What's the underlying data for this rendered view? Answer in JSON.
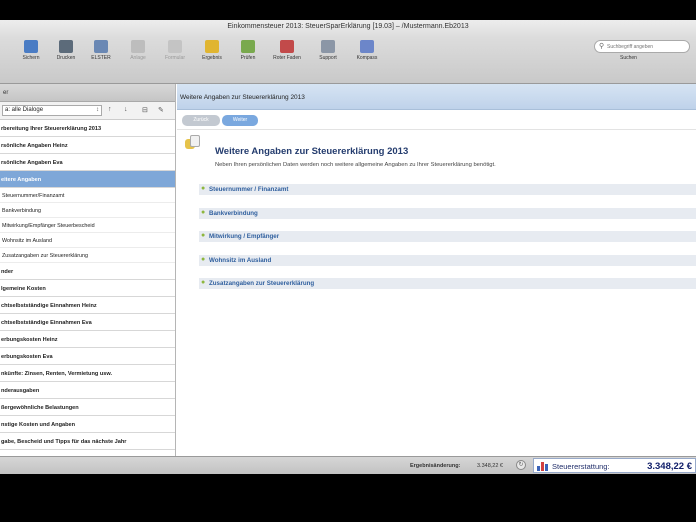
{
  "window": {
    "title": "Einkommensteuer 2013: SteuerSparErklärung [19.03] – /Mustermann.Eb2013"
  },
  "toolbar": {
    "buttons": [
      {
        "label": "Sichern",
        "icon": "save-icon",
        "color": "#4a7cc4",
        "enabled": true
      },
      {
        "label": "Drucken",
        "icon": "printer-icon",
        "color": "#5c6b7a",
        "enabled": true
      },
      {
        "label": "ELSTER",
        "icon": "elster-send-icon",
        "color": "#6a88b4",
        "enabled": true
      },
      {
        "label": "Anlage",
        "icon": "attachment-icon",
        "color": "#bdbdbd",
        "enabled": false
      },
      {
        "label": "Formular",
        "icon": "magnifier-icon",
        "color": "#c4c4c4",
        "enabled": false
      },
      {
        "label": "Ergebnis",
        "icon": "result-icon",
        "color": "#e0b531",
        "enabled": true
      },
      {
        "label": "Prüfen",
        "icon": "check-icon",
        "color": "#79a94e",
        "enabled": true
      },
      {
        "label": "Roter Faden",
        "icon": "red-thread-icon",
        "color": "#c24a4a",
        "enabled": true
      },
      {
        "label": "Support",
        "icon": "support-icon",
        "color": "#8b96a6",
        "enabled": true
      },
      {
        "label": "Kompass",
        "icon": "compass-icon",
        "color": "#6c86c9",
        "enabled": true
      }
    ],
    "search": {
      "placeholder": "Suchbegriff angeben",
      "label": "Suchen"
    }
  },
  "sidebar": {
    "header": "er",
    "filter": {
      "selected": "a: alle Dialoge"
    },
    "items": [
      {
        "label": "rbereitung Ihrer Steuererklärung 2013",
        "type": "main",
        "selected": false
      },
      {
        "label": "rsönliche Angaben Heinz",
        "type": "main",
        "selected": false
      },
      {
        "label": "rsönliche Angaben Eva",
        "type": "main",
        "selected": false
      },
      {
        "label": "eitere Angaben",
        "type": "main",
        "selected": true
      },
      {
        "label": "Steuernummer/Finanzamt",
        "type": "sub",
        "selected": false
      },
      {
        "label": "Bankverbindung",
        "type": "sub",
        "selected": false
      },
      {
        "label": "Mitwirkung/Empfänger Steuerbescheid",
        "type": "sub",
        "selected": false
      },
      {
        "label": "Wohnsitz im Ausland",
        "type": "sub",
        "selected": false
      },
      {
        "label": "Zusatzangaben zur Steuererklärung",
        "type": "sub",
        "selected": false
      },
      {
        "label": "nder",
        "type": "main",
        "selected": false
      },
      {
        "label": "lgemeine Kosten",
        "type": "main",
        "selected": false
      },
      {
        "label": "chtselbstständige Einnahmen Heinz",
        "type": "main",
        "selected": false
      },
      {
        "label": "chtselbstständige Einnahmen Eva",
        "type": "main",
        "selected": false
      },
      {
        "label": "erbungskosten Heinz",
        "type": "main",
        "selected": false
      },
      {
        "label": "erbungskosten Eva",
        "type": "main",
        "selected": false
      },
      {
        "label": "nkünfte: Zinsen, Renten, Vermietung usw.",
        "type": "main",
        "selected": false
      },
      {
        "label": "nderausgaben",
        "type": "main",
        "selected": false
      },
      {
        "label": "ßergewöhnliche Belastungen",
        "type": "main",
        "selected": false
      },
      {
        "label": "nstige Kosten und Angaben",
        "type": "main",
        "selected": false
      },
      {
        "label": "gabe, Bescheid und Tipps für das nächste Jahr",
        "type": "main",
        "selected": false
      }
    ]
  },
  "content": {
    "header": "Weitere Angaben zur Steuererklärung 2013",
    "nav": {
      "prev": "Zurück",
      "next": "Weiter"
    },
    "page_title": "Weitere Angaben zur Steuererklärung 2013",
    "page_desc": "Neben Ihren persönlichen Daten werden noch weitere allgemeine Angaben zu Ihrer Steuererklärung benötigt.",
    "sections": [
      "Steuernummer / Finanzamt",
      "Bankverbindung",
      "Mitwirkung / Empfänger",
      "Wohnsitz im Ausland",
      "Zusatzangaben zur Steuererklärung"
    ]
  },
  "status": {
    "result_label": "Ergebnisänderung:",
    "result_value": "3.348,22 €",
    "refund_label": "Steuererstattung:",
    "refund_value": "3.348,22 €",
    "accent": "#12206b"
  }
}
